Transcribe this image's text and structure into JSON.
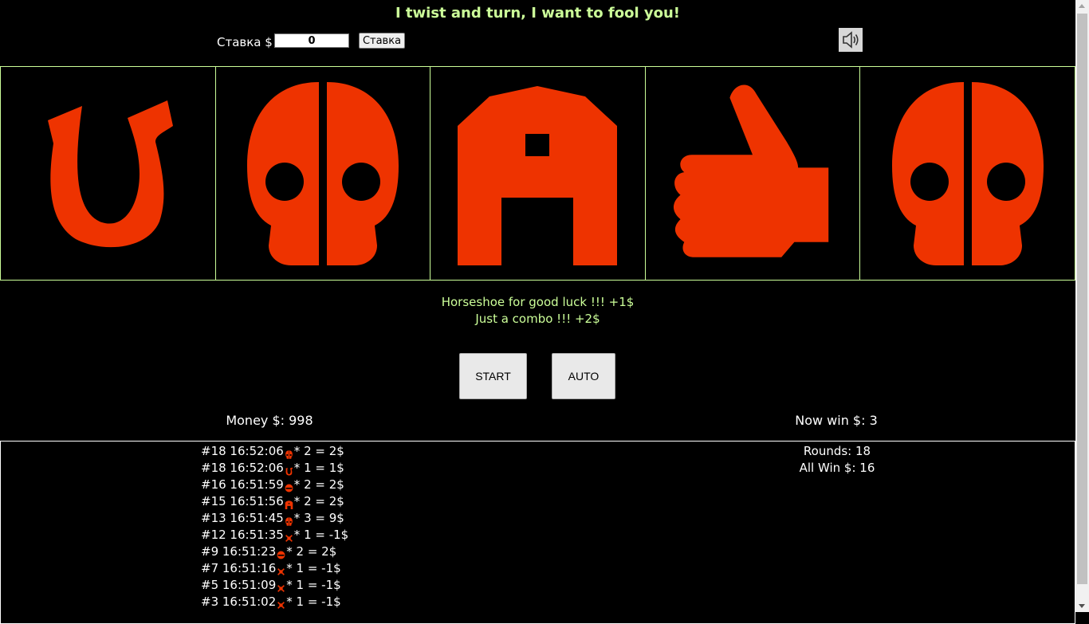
{
  "title": "I twist and turn, I want to fool you!",
  "bet": {
    "label": "Ставка $",
    "value": "0",
    "button_label": "Ставка"
  },
  "sound_icon": "speaker-icon",
  "reels": [
    "horseshoe-icon",
    "skull-icon",
    "house-icon",
    "thumbs-up-icon",
    "skull-icon"
  ],
  "symbol_color": "#ee3300",
  "accent_color": "#ccff99",
  "messages": [
    "Horseshoe for good luck !!! +1$",
    "Just a combo !!! +2$"
  ],
  "buttons": {
    "start": "START",
    "auto": "AUTO"
  },
  "money": "Money $: 998",
  "now_win": "Now win $: 3",
  "history": [
    {
      "prefix": "#18 16:52:06",
      "icon": "skull-icon",
      "suffix": "* 2 = 2$"
    },
    {
      "prefix": "#18 16:52:06",
      "icon": "horseshoe-icon",
      "suffix": "* 1 = 1$"
    },
    {
      "prefix": "#16 16:51:59",
      "icon": "dome-icon",
      "suffix": "* 2 = 2$"
    },
    {
      "prefix": "#15 16:51:56",
      "icon": "house-icon",
      "suffix": "* 2 = 2$"
    },
    {
      "prefix": "#13 16:51:45",
      "icon": "skull-icon",
      "suffix": "* 3 = 9$"
    },
    {
      "prefix": "#12 16:51:35",
      "icon": "crossbones-icon",
      "suffix": "* 1 = -1$"
    },
    {
      "prefix": "#9 16:51:23",
      "icon": "dome-icon",
      "suffix": "* 2 = 2$"
    },
    {
      "prefix": "#7 16:51:16",
      "icon": "crossbones-icon",
      "suffix": "* 1 = -1$"
    },
    {
      "prefix": "#5 16:51:09",
      "icon": "crossbones-icon",
      "suffix": "* 1 = -1$"
    },
    {
      "prefix": "#3 16:51:02",
      "icon": "crossbones-icon",
      "suffix": "* 1 = -1$"
    }
  ],
  "stats": {
    "rounds": "Rounds: 18",
    "all_win": "All Win $: 16"
  }
}
